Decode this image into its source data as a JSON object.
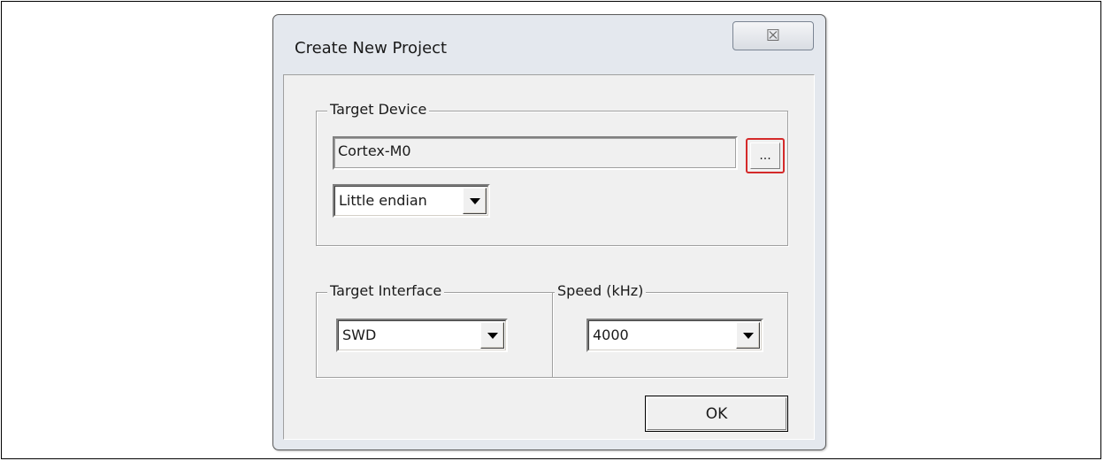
{
  "dialog": {
    "title": "Create New Project",
    "close_symbol": "☒"
  },
  "target_device": {
    "label": "Target Device",
    "device_value": "Cortex-M0",
    "browse_label": "...",
    "endian_value": "Little endian"
  },
  "target_interface": {
    "label": "Target Interface",
    "value": "SWD"
  },
  "speed": {
    "label": "Speed (kHz)",
    "value": "4000"
  },
  "buttons": {
    "ok_label": "OK"
  },
  "colors": {
    "highlight_border": "#d42a2a",
    "dialog_frame": "#e4e8ee",
    "client_bg": "#f0f0f0"
  }
}
